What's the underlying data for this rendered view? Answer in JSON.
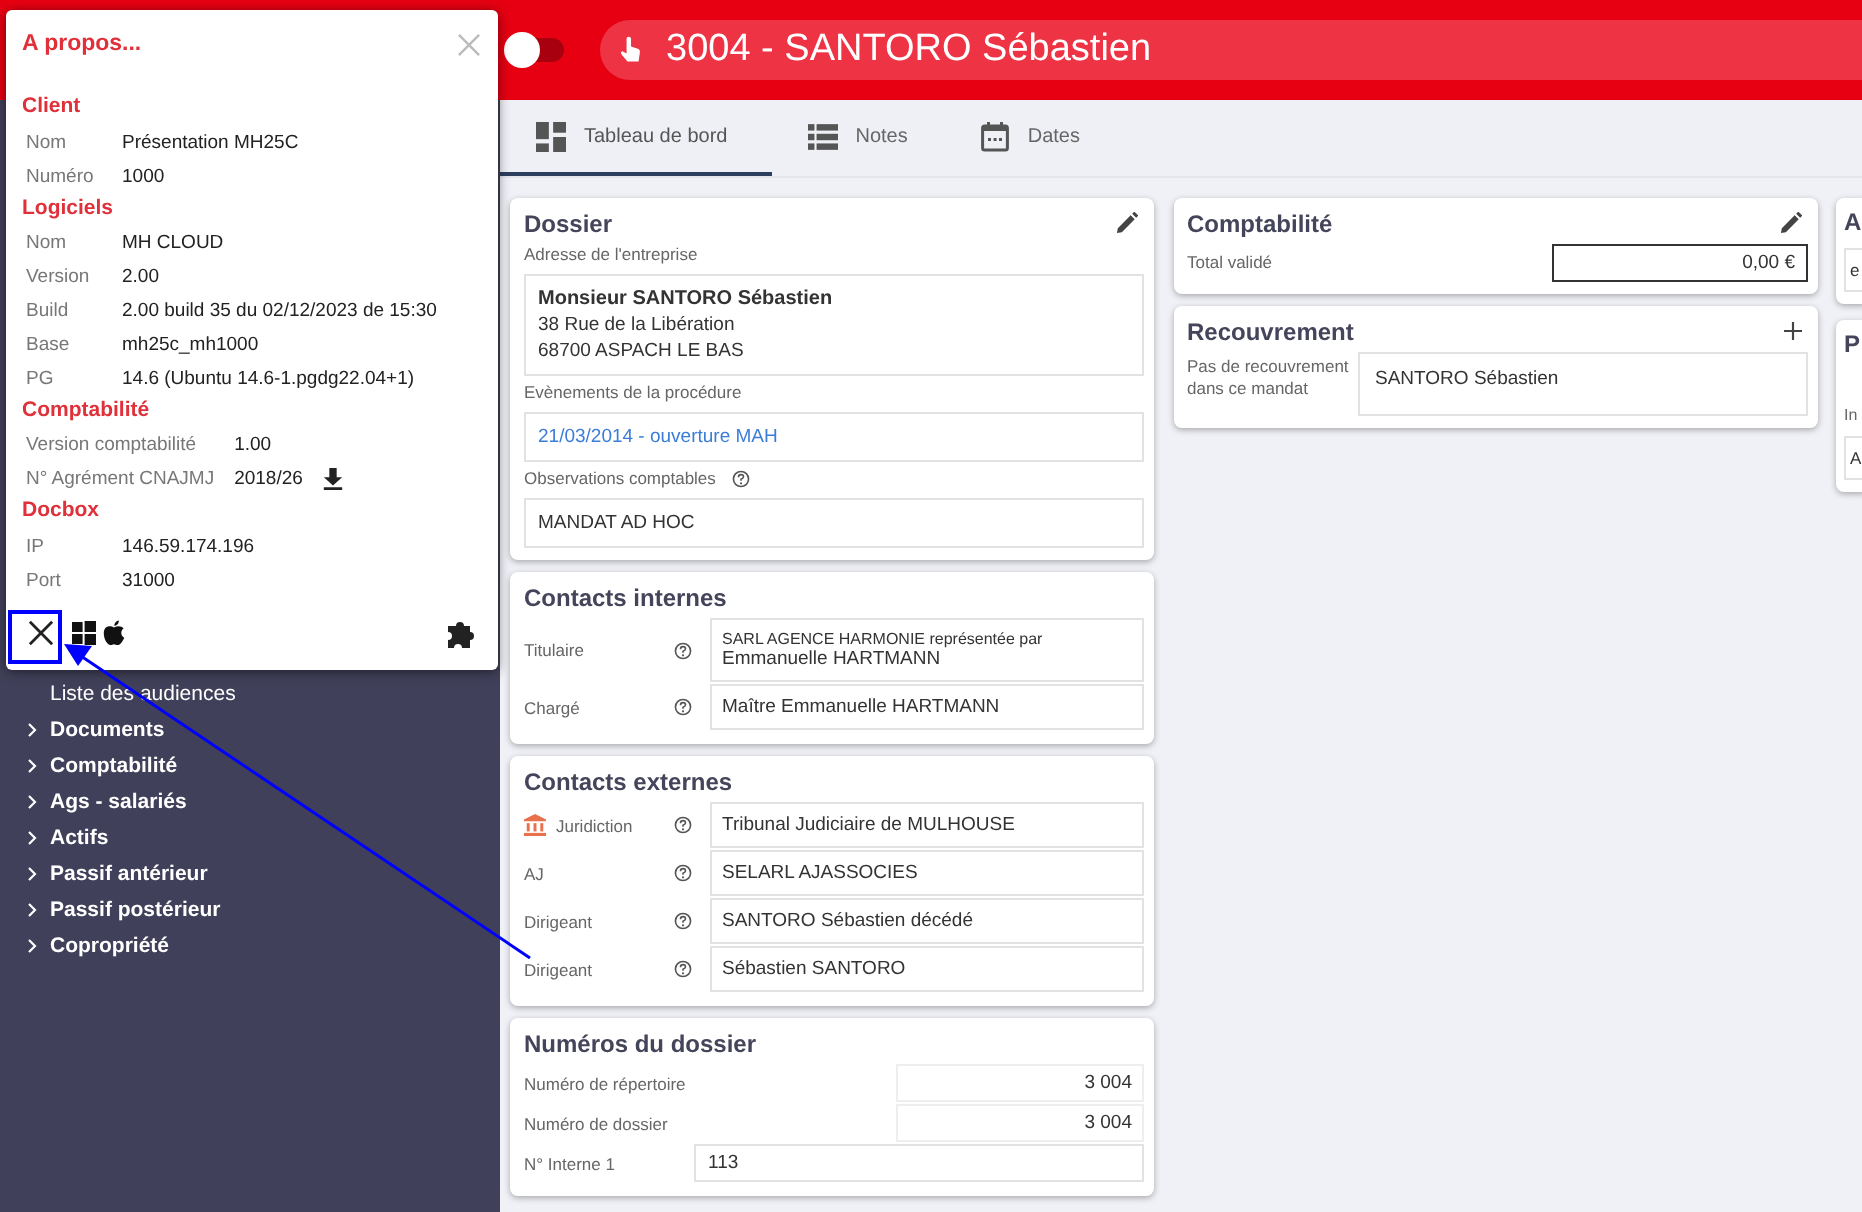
{
  "header": {
    "toggle_on": false,
    "title": "3004 - SANTORO Sébastien"
  },
  "about": {
    "title": "A propos...",
    "sections": [
      {
        "title": "Client",
        "rows": [
          {
            "label": "Nom",
            "value": "Présentation MH25C"
          },
          {
            "label": "Numéro",
            "value": "1000"
          }
        ]
      },
      {
        "title": "Logiciels",
        "rows": [
          {
            "label": "Nom",
            "value": "MH CLOUD"
          },
          {
            "label": "Version",
            "value": "2.00"
          },
          {
            "label": "Build",
            "value": "2.00 build 35 du 02/12/2023 de 15:30"
          },
          {
            "label": "Base",
            "value": "mh25c_mh1000"
          },
          {
            "label": "PG",
            "value": "14.6 (Ubuntu 14.6-1.pgdg22.04+1)"
          }
        ]
      },
      {
        "title": "Comptabilité",
        "rows": [
          {
            "label": "Version comptabilité",
            "value": "1.00"
          },
          {
            "label": "N° Agrément CNAJMJ",
            "value": "2018/26",
            "download": true
          }
        ]
      },
      {
        "title": "Docbox",
        "rows": [
          {
            "label": "IP",
            "value": "146.59.174.196"
          },
          {
            "label": "Port",
            "value": "31000"
          }
        ]
      }
    ]
  },
  "sidebar": {
    "items": [
      {
        "label": "Liste des audiences",
        "kind": "link"
      },
      {
        "label": "Documents",
        "kind": "group",
        "expanded": false
      },
      {
        "label": "Comptabilité",
        "kind": "group",
        "expanded": false
      },
      {
        "label": "Ags - salariés",
        "kind": "group",
        "expanded": false
      },
      {
        "label": "Actifs",
        "kind": "group",
        "expanded": false
      },
      {
        "label": "Passif antérieur",
        "kind": "group",
        "expanded": false
      },
      {
        "label": "Passif postérieur",
        "kind": "group",
        "expanded": false
      },
      {
        "label": "Copropriété",
        "kind": "group",
        "expanded": false
      }
    ]
  },
  "tabs": [
    {
      "label": "Tableau de bord",
      "kind": "dashboard",
      "selected": true
    },
    {
      "label": "Notes",
      "kind": "list",
      "selected": false
    },
    {
      "label": "Dates",
      "kind": "calendar",
      "selected": false
    }
  ],
  "dossier": {
    "title": "Dossier",
    "address_label": "Adresse de l'entreprise",
    "address": {
      "name": "Monsieur SANTORO Sébastien",
      "lines": [
        "38 Rue de la Libération",
        "68700 ASPACH LE BAS"
      ]
    },
    "events_label": "Evènements de la procédure",
    "events": [
      "21/03/2014 - ouverture MAH"
    ],
    "observations_label": "Observations comptables",
    "observations": "MANDAT AD HOC"
  },
  "contacts_internes": {
    "title": "Contacts internes",
    "rows": [
      {
        "label": "Titulaire",
        "lines": [
          "SARL AGENCE HARMONIE représentée par",
          "Emmanuelle HARTMANN"
        ]
      },
      {
        "label": "Chargé",
        "lines": [
          "Maître Emmanuelle HARTMANN"
        ]
      }
    ]
  },
  "contacts_externes": {
    "title": "Contacts externes",
    "rows": [
      {
        "label": "Juridiction",
        "kind": "court",
        "value": "Tribunal Judiciaire de MULHOUSE"
      },
      {
        "label": "AJ",
        "kind": "person",
        "value": "SELARL AJASSOCIES"
      },
      {
        "label": "Dirigeant",
        "kind": "person",
        "value": "SANTORO Sébastien décédé"
      },
      {
        "label": "Dirigeant",
        "kind": "person",
        "value": "Sébastien SANTORO"
      }
    ]
  },
  "numeros": {
    "title": "Numéros du dossier",
    "rows": [
      {
        "label": "Numéro de répertoire",
        "value": "3 004",
        "kind": "readonly"
      },
      {
        "label": "Numéro de dossier",
        "value": "3 004",
        "kind": "readonly"
      },
      {
        "label": "N° Interne 1",
        "value": "113",
        "kind": "input"
      }
    ]
  },
  "comptabilite": {
    "title": "Comptabilité",
    "total_label": "Total validé",
    "total": "0,00 €"
  },
  "recouvrement": {
    "title": "Recouvrement",
    "label": "Pas de recouvrement dans ce mandat",
    "value": "SANTORO Sébastien"
  },
  "column_3": [
    {
      "title": "A",
      "field": "e"
    },
    {
      "title": "P",
      "label": "In",
      "field": "A"
    }
  ]
}
